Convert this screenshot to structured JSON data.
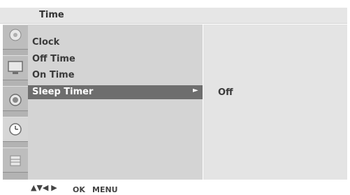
{
  "header": {
    "title": "Time"
  },
  "sidebar": {
    "icons": [
      {
        "name": "picture-disc-icon"
      },
      {
        "name": "screen-icon"
      },
      {
        "name": "speaker-icon"
      },
      {
        "name": "clock-icon",
        "selected": true
      },
      {
        "name": "option-icon"
      }
    ]
  },
  "menu": {
    "items": [
      {
        "label": "Clock"
      },
      {
        "label": "Off Time"
      },
      {
        "label": "On Time"
      },
      {
        "label": "Sleep Timer",
        "selected": true
      }
    ],
    "arrow": "►"
  },
  "value": {
    "text": "Off"
  },
  "footer": {
    "nav_arrows": "▲▼◀ ▶",
    "ok_label": "OK",
    "menu_label": "MENU"
  }
}
